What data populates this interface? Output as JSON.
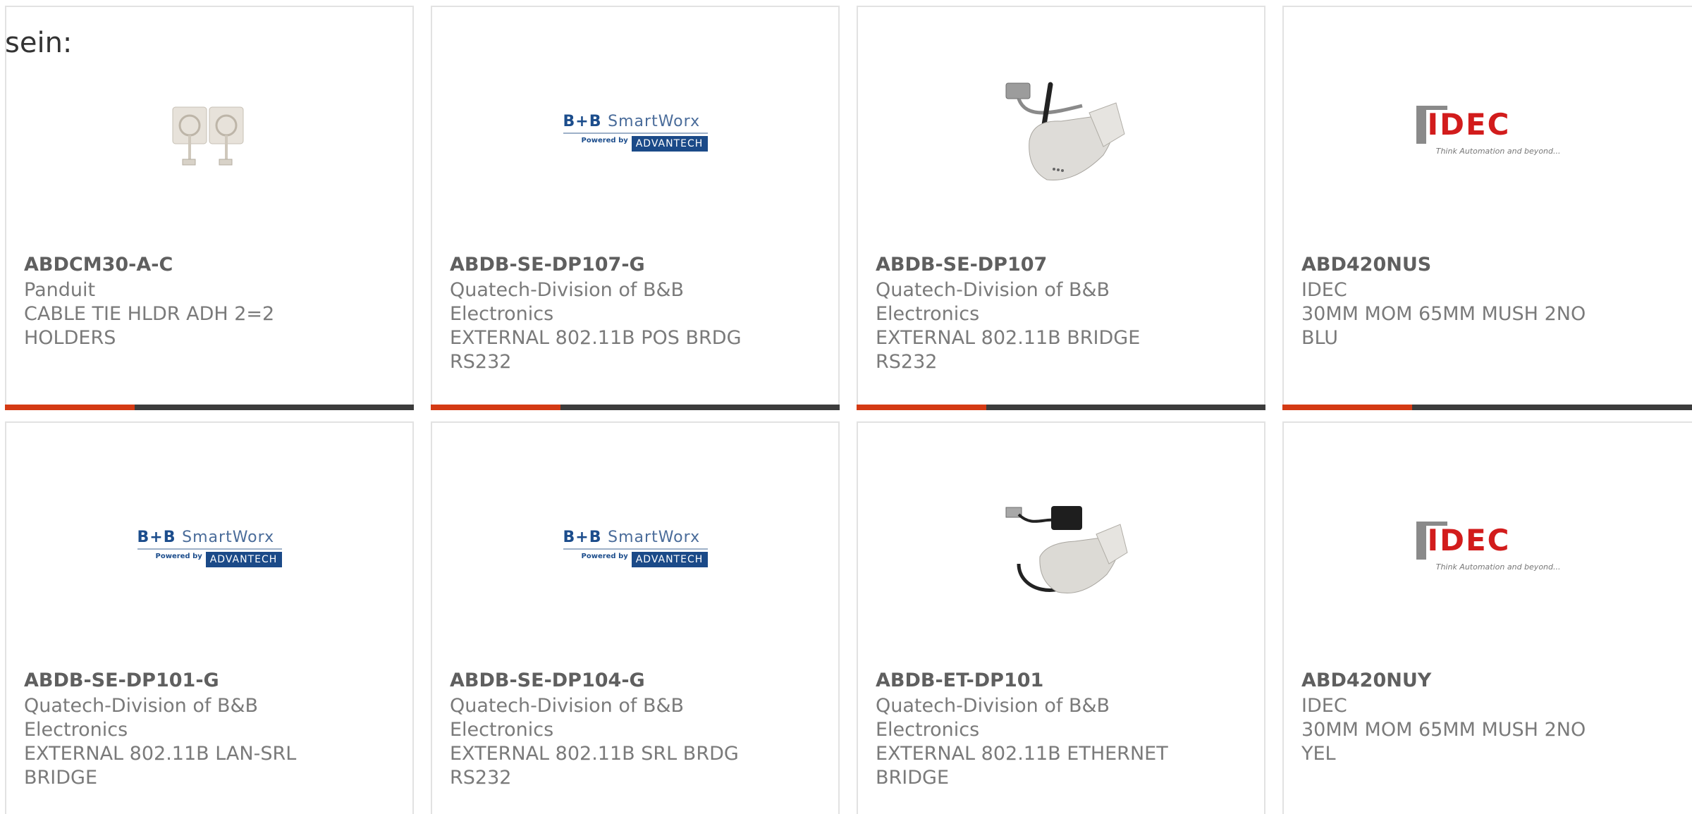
{
  "intro_text": "sein:",
  "colors": {
    "accent": "#d43a14",
    "bar": "#3c3c3c",
    "border": "#e2e2e2"
  },
  "products": [
    {
      "part": "ABDCM30-A-C",
      "maker": "Panduit",
      "desc": "CABLE TIE HLDR ADH 2=2 HOLDERS",
      "image": "cable-tie-holder-image"
    },
    {
      "part": "ABDB-SE-DP107-G",
      "maker": "Quatech-Division of B&B Electronics",
      "desc": "EXTERNAL 802.11B POS BRDG RS232",
      "image": "bb-smartworx-logo"
    },
    {
      "part": "ABDB-SE-DP107",
      "maker": "Quatech-Division of B&B Electronics",
      "desc": "EXTERNAL 802.11B BRIDGE RS232",
      "image": "wireless-bridge-image"
    },
    {
      "part": "ABD420NUS",
      "maker": "IDEC",
      "desc": "30MM MOM 65MM MUSH 2NO BLU",
      "image": "idec-logo"
    },
    {
      "part": "ABDB-SE-DP101-G",
      "maker": "Quatech-Division of B&B Electronics",
      "desc": "EXTERNAL 802.11B LAN-SRL BRIDGE",
      "image": "bb-smartworx-logo"
    },
    {
      "part": "ABDB-SE-DP104-G",
      "maker": "Quatech-Division of B&B Electronics",
      "desc": "EXTERNAL 802.11B SRL BRDG RS232",
      "image": "bb-smartworx-logo"
    },
    {
      "part": "ABDB-ET-DP101",
      "maker": "Quatech-Division of B&B Electronics",
      "desc": "EXTERNAL 802.11B ETHERNET BRIDGE",
      "image": "ethernet-bridge-image"
    },
    {
      "part": "ABD420NUY",
      "maker": "IDEC",
      "desc": "30MM MOM 65MM MUSH 2NO YEL",
      "image": "idec-logo"
    }
  ],
  "logos": {
    "bb_top": "B+B",
    "bb_sw": "SmartWorx",
    "bb_powered": "Powered by",
    "bb_advantech": "ADVANTECH",
    "idec_text": "IDEC",
    "idec_tag": "Think Automation and beyond..."
  }
}
